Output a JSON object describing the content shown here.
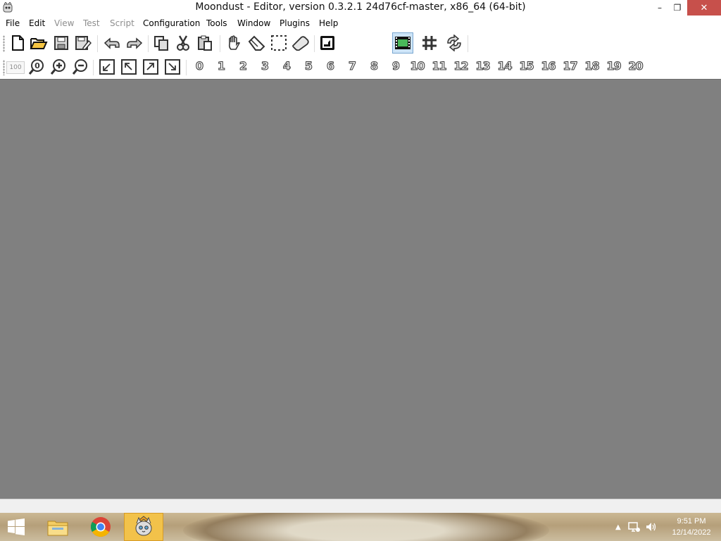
{
  "window": {
    "title": "Moondust - Editor, version 0.3.2.1 24d76cf-master, x86_64 (64-bit)",
    "controls": {
      "minimize": "–",
      "maximize": "❐",
      "close": "✕"
    }
  },
  "menu": {
    "items": [
      {
        "label": "File",
        "enabled": true
      },
      {
        "label": "Edit",
        "enabled": true
      },
      {
        "label": "View",
        "enabled": false
      },
      {
        "label": "Test",
        "enabled": false
      },
      {
        "label": "Script",
        "enabled": false
      },
      {
        "label": "Configuration",
        "enabled": true
      },
      {
        "label": "Tools",
        "enabled": true
      },
      {
        "label": "Window",
        "enabled": true
      },
      {
        "label": "Plugins",
        "enabled": true
      },
      {
        "label": "Help",
        "enabled": true
      }
    ]
  },
  "toolbar": {
    "zoom_value": "100",
    "layers": [
      "0",
      "1",
      "2",
      "3",
      "4",
      "5",
      "6",
      "7",
      "8",
      "9",
      "10",
      "11",
      "12",
      "13",
      "14",
      "15",
      "16",
      "17",
      "18",
      "19",
      "20"
    ],
    "icons": [
      "new-file-icon",
      "open-folder-icon",
      "save-icon",
      "save-as-icon",
      "undo-icon",
      "redo-icon",
      "copy-icon",
      "cut-icon",
      "paste-icon",
      "hand-icon",
      "eraser-icon",
      "selection-icon",
      "resize-icon",
      "properties-icon",
      "animation-icon",
      "grid-icon",
      "sync-icon"
    ]
  },
  "taskbar": {
    "time": "9:51 PM",
    "date": "12/14/2022"
  },
  "colors": {
    "workspace": "#808080",
    "accent_active": "#f2c24a",
    "close_button": "#c7504b"
  }
}
